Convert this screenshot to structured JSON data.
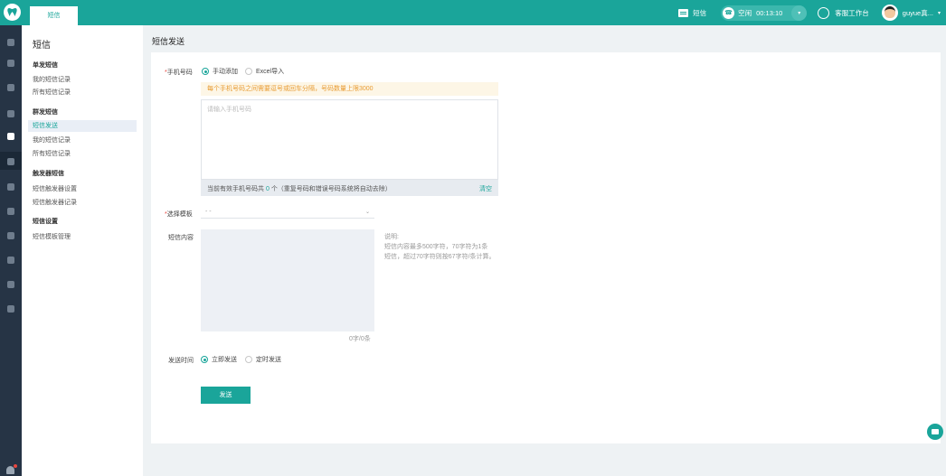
{
  "top": {
    "active_tab": "短信",
    "sms_label": "短信",
    "status_label": "空闲",
    "timer": "00:13:10",
    "workbench_label": "客服工作台",
    "user_name": "guyue真..."
  },
  "sidenav": {
    "title": "短信",
    "groups": [
      {
        "label": "单发短信",
        "items": [
          "我的短信记录",
          "所有短信记录"
        ]
      },
      {
        "label": "群发短信",
        "items": [
          "短信发送",
          "我的短信记录",
          "所有短信记录"
        ]
      },
      {
        "label": "触发器短信",
        "items": [
          "短信触发器设置",
          "短信触发器记录"
        ]
      },
      {
        "label": "短信设置",
        "items": [
          "短信模板管理"
        ]
      }
    ],
    "active_item": "短信发送"
  },
  "header": {
    "title": "短信发送"
  },
  "form": {
    "phone_label": "手机号码",
    "phone_required": "*",
    "opt_manual": "手动添加",
    "opt_excel": "Excel导入",
    "warning": "每个手机号码之间需要逗号或回车分隔，号码数量上限3000",
    "phone_placeholder": "请输入手机号码",
    "count_prefix": "当前有效手机号码共",
    "count_value": "0",
    "count_suffix": "个（重复号码和错误号码系统将自动去除）",
    "clear_label": "清空",
    "template_label": "选择模板",
    "template_required": "*",
    "template_value": "- -",
    "content_label": "短信内容",
    "content_counter": "0字/0条",
    "desc_title": "说明:",
    "desc_line1": "短信内容最多500字符，70字符为1条",
    "desc_line2": "短信，超过70字符则按67字符/条计算。",
    "send_time_label": "发送时间",
    "opt_now": "立即发送",
    "opt_scheduled": "定时发送",
    "send_button": "发送"
  },
  "colors": {
    "accent": "#1aa59a",
    "rail": "#263445",
    "warning_bg": "#fdf6e6",
    "warning_text": "#e89b31"
  }
}
